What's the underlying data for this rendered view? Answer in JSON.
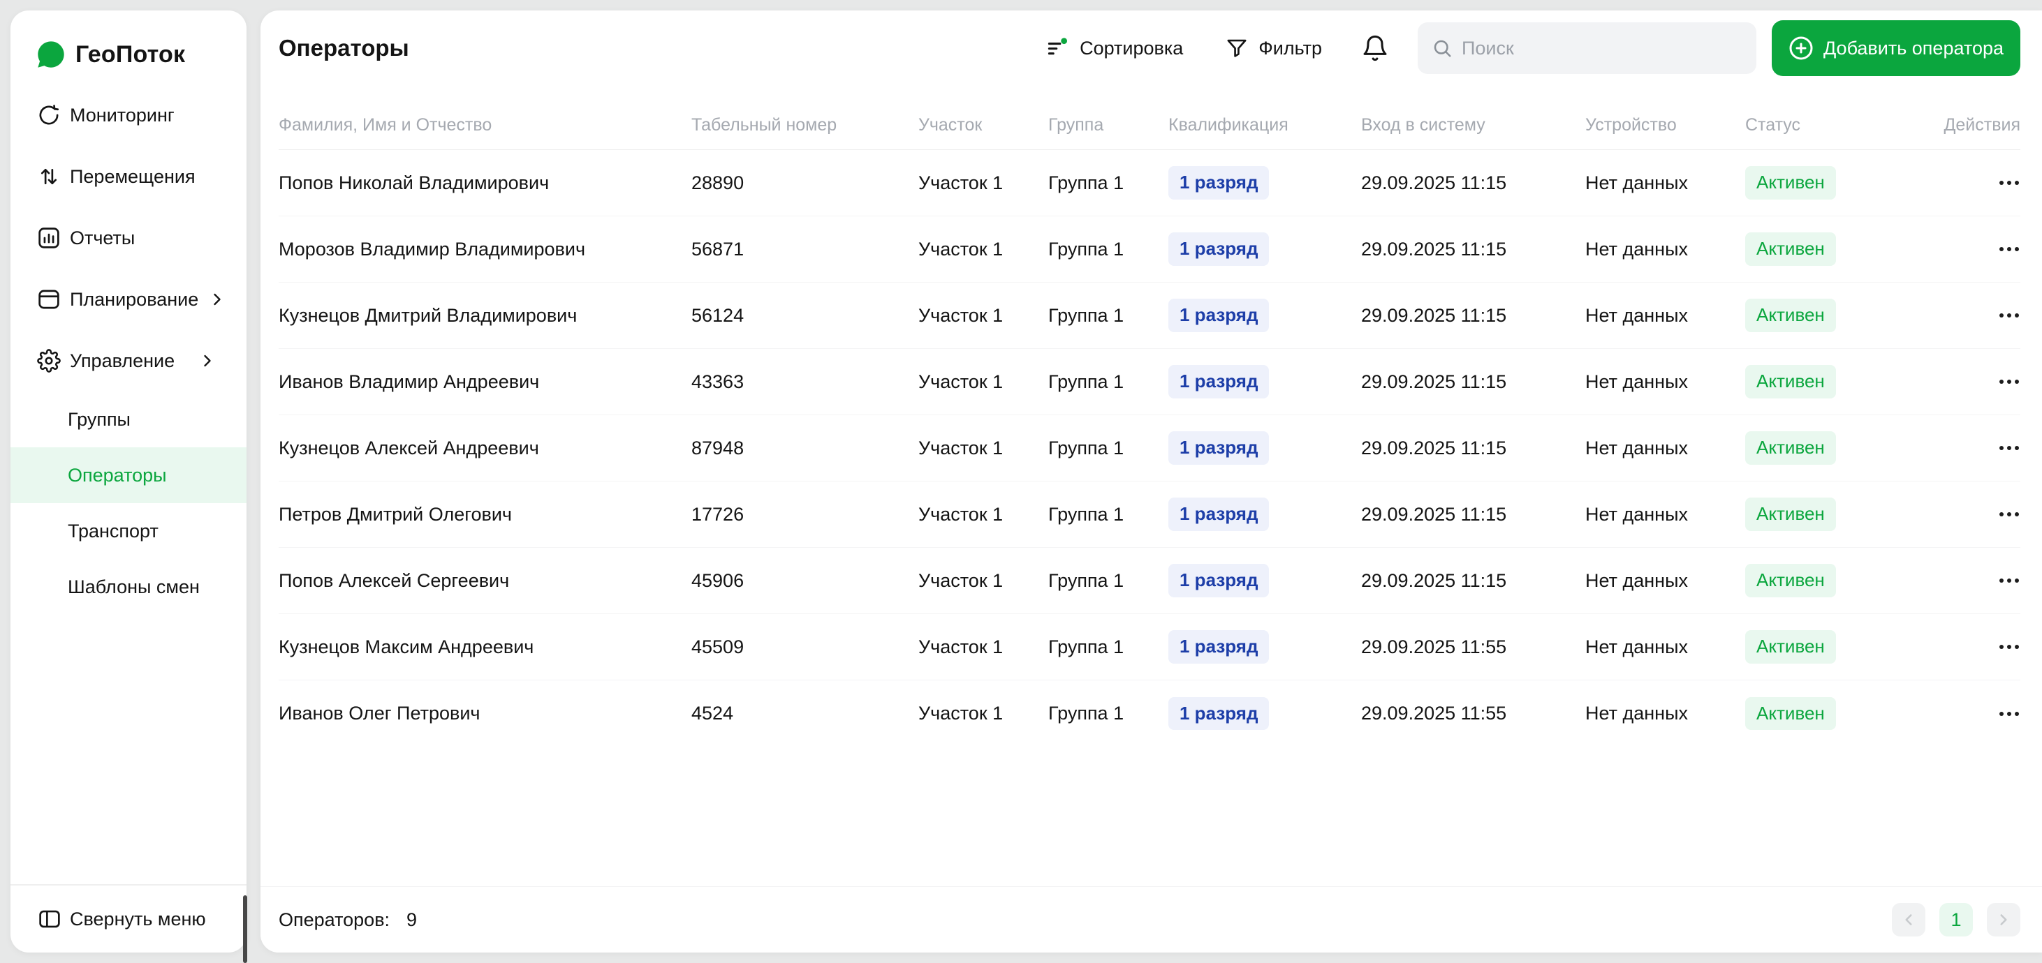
{
  "app": {
    "name": "ГеоПоток"
  },
  "colors": {
    "accent": "#0BA63E",
    "accent_bg": "#E9F8EF",
    "qual_text": "#1D3EA8",
    "qual_bg": "#EEF1FB",
    "muted": "#A5A9B0",
    "ink": "#141414"
  },
  "sidebar": {
    "items": [
      {
        "label": "Мониторинг",
        "icon": "monitoring-icon"
      },
      {
        "label": "Перемещения",
        "icon": "movements-icon"
      },
      {
        "label": "Отчеты",
        "icon": "reports-icon"
      },
      {
        "label": "Планирование",
        "icon": "planning-icon",
        "expandable": true
      },
      {
        "label": "Управление",
        "icon": "gear-icon",
        "expandable": true,
        "expanded": true
      }
    ],
    "subitems": [
      {
        "label": "Группы"
      },
      {
        "label": "Операторы",
        "active": true
      },
      {
        "label": "Транспорт"
      },
      {
        "label": "Шаблоны смен"
      }
    ],
    "collapse_label": "Свернуть меню"
  },
  "header": {
    "title": "Операторы",
    "sort_label": "Сортировка",
    "filter_label": "Фильтр",
    "search_placeholder": "Поиск",
    "add_button_label": "Добавить оператора"
  },
  "table": {
    "columns": [
      "Фамилия, Имя и Отчество",
      "Табельный номер",
      "Участок",
      "Группа",
      "Квалификация",
      "Вход в систему",
      "Устройство",
      "Статус",
      "Действия"
    ],
    "rows": [
      {
        "name": "Попов Николай Владимирович",
        "number": "28890",
        "section": "Участок 1",
        "group": "Группа 1",
        "qualification": "1 разряд",
        "login": "29.09.2025 11:15",
        "device": "Нет данных",
        "status": "Активен"
      },
      {
        "name": "Морозов Владимир Владимирович",
        "number": "56871",
        "section": "Участок 1",
        "group": "Группа 1",
        "qualification": "1 разряд",
        "login": "29.09.2025 11:15",
        "device": "Нет данных",
        "status": "Активен"
      },
      {
        "name": "Кузнецов Дмитрий Владимирович",
        "number": "56124",
        "section": "Участок 1",
        "group": "Группа 1",
        "qualification": "1 разряд",
        "login": "29.09.2025 11:15",
        "device": "Нет данных",
        "status": "Активен"
      },
      {
        "name": "Иванов Владимир Андреевич",
        "number": "43363",
        "section": "Участок 1",
        "group": "Группа 1",
        "qualification": "1 разряд",
        "login": "29.09.2025 11:15",
        "device": "Нет данных",
        "status": "Активен"
      },
      {
        "name": "Кузнецов Алексей Андреевич",
        "number": "87948",
        "section": "Участок 1",
        "group": "Группа 1",
        "qualification": "1 разряд",
        "login": "29.09.2025 11:15",
        "device": "Нет данных",
        "status": "Активен"
      },
      {
        "name": "Петров Дмитрий Олегович",
        "number": "17726",
        "section": "Участок 1",
        "group": "Группа 1",
        "qualification": "1 разряд",
        "login": "29.09.2025 11:15",
        "device": "Нет данных",
        "status": "Активен"
      },
      {
        "name": "Попов Алексей Сергеевич",
        "number": "45906",
        "section": "Участок 1",
        "group": "Группа 1",
        "qualification": "1 разряд",
        "login": "29.09.2025 11:15",
        "device": "Нет данных",
        "status": "Активен"
      },
      {
        "name": "Кузнецов Максим Андреевич",
        "number": "45509",
        "section": "Участок 1",
        "group": "Группа 1",
        "qualification": "1 разряд",
        "login": "29.09.2025 11:55",
        "device": "Нет данных",
        "status": "Активен"
      },
      {
        "name": "Иванов Олег Петрович",
        "number": "4524",
        "section": "Участок 1",
        "group": "Группа 1",
        "qualification": "1 разряд",
        "login": "29.09.2025 11:55",
        "device": "Нет данных",
        "status": "Активен"
      }
    ]
  },
  "footer": {
    "count_label": "Операторов:",
    "count": "9",
    "pagination": {
      "page": "1",
      "prev_icon": "chevron-left-icon",
      "next_icon": "chevron-right-icon"
    }
  }
}
